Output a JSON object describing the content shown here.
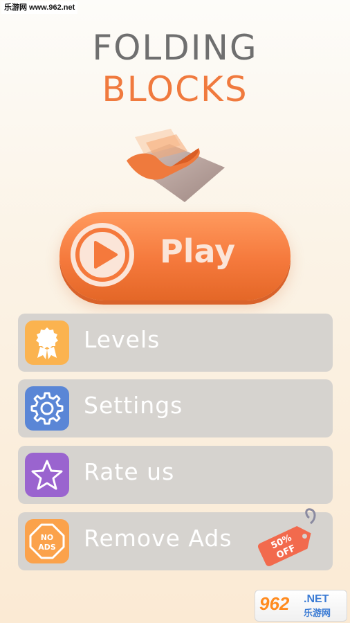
{
  "watermark": {
    "top": "乐游网 www.962.net",
    "bottom_num": "962",
    "bottom_net": ".NET",
    "bottom_cn": "乐游网"
  },
  "title": {
    "line1": "FOLDING",
    "line2": "BLOCKS"
  },
  "play": {
    "label": "Play",
    "icon": "play-icon"
  },
  "menu": [
    {
      "label": "Levels",
      "icon": "ribbon-badge-icon",
      "color": "#fbb34f"
    },
    {
      "label": "Settings",
      "icon": "gear-icon",
      "color": "#5a86d6"
    },
    {
      "label": "Rate us",
      "icon": "star-icon",
      "color": "#9a64cf"
    },
    {
      "label": "Remove Ads",
      "icon": "no-ads-icon",
      "color": "#fba24b",
      "tag": {
        "line1": "50%",
        "line2": "OFF",
        "color": "#f26a4d"
      }
    }
  ],
  "colors": {
    "accent": "#f5793c",
    "title_gray": "#6f6f6f",
    "menu_bg": "#d6d3cf"
  }
}
